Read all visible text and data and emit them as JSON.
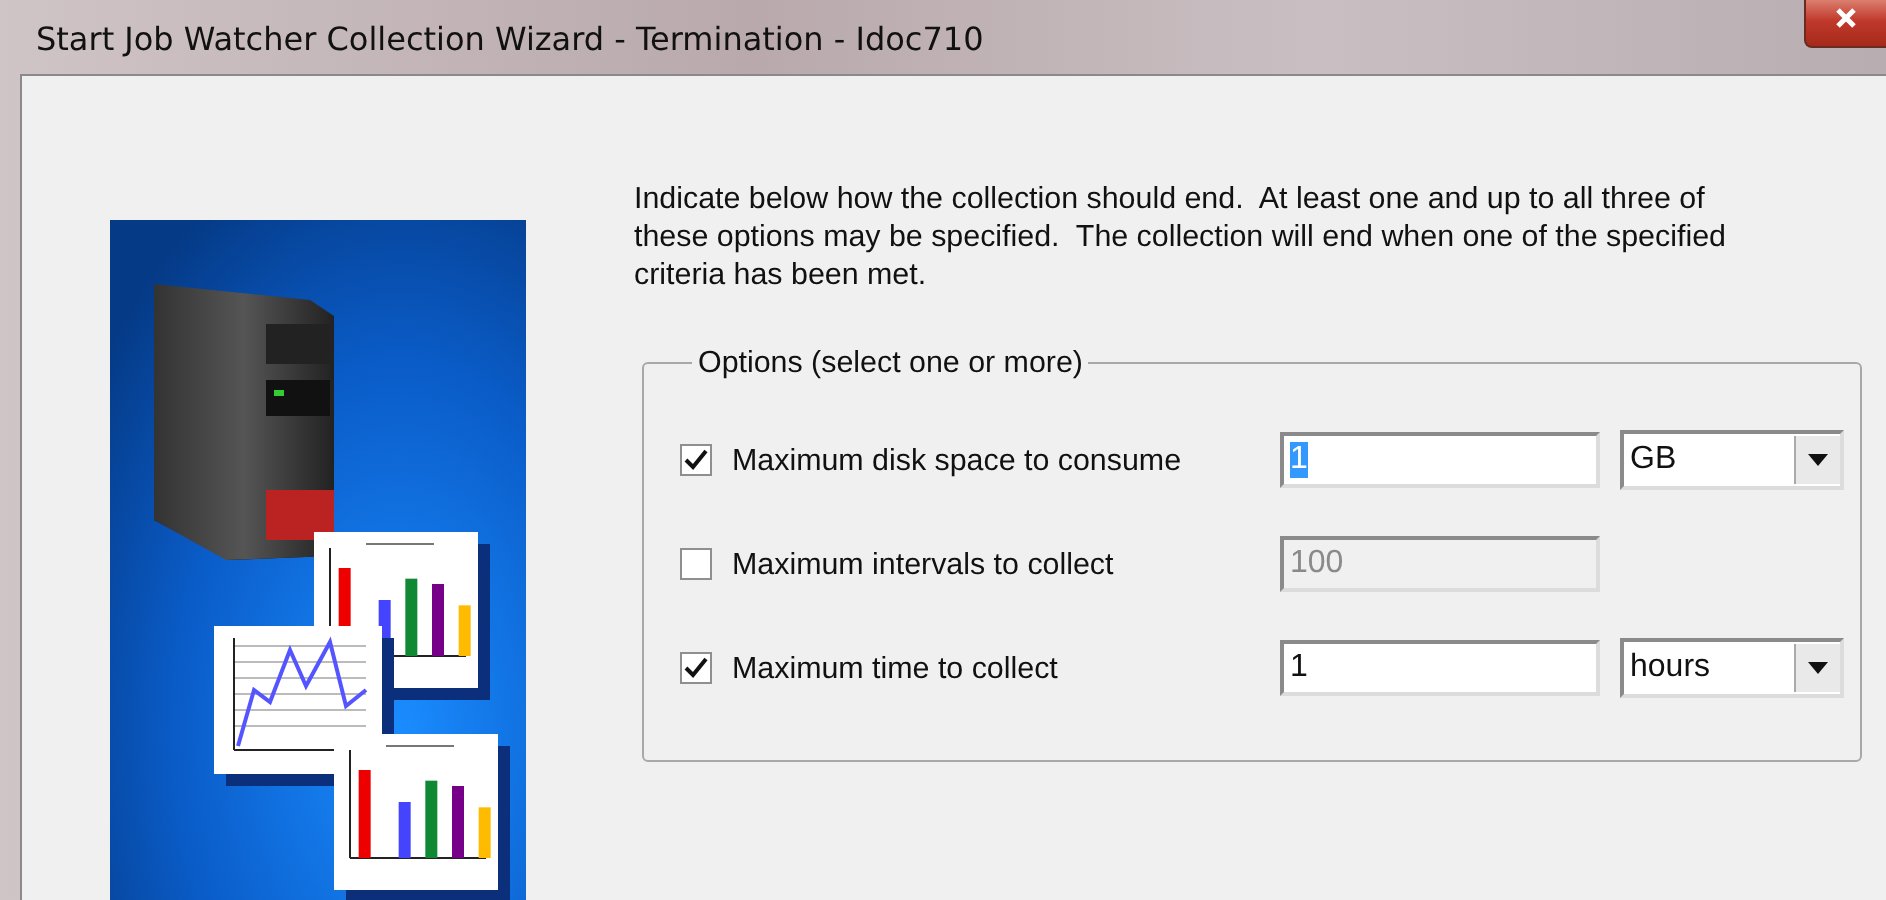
{
  "window": {
    "title": "Start Job Watcher Collection Wizard - Termination - Idoc710"
  },
  "instructions": "Indicate below how the collection should end.  At least one and up to all three of these options may be specified.  The collection will end when one of the specified criteria has been met.",
  "options_group": {
    "label": "Options (select one or more)",
    "options": [
      {
        "label": "Maximum disk space to consume",
        "checked": true,
        "value": "1",
        "value_selected": true,
        "disabled": false,
        "unit": "GB"
      },
      {
        "label": "Maximum intervals to collect",
        "checked": false,
        "value": "100",
        "value_selected": false,
        "disabled": true
      },
      {
        "label": "Maximum time to collect",
        "checked": true,
        "value": "1",
        "value_selected": false,
        "disabled": false,
        "unit": "hours"
      }
    ]
  }
}
